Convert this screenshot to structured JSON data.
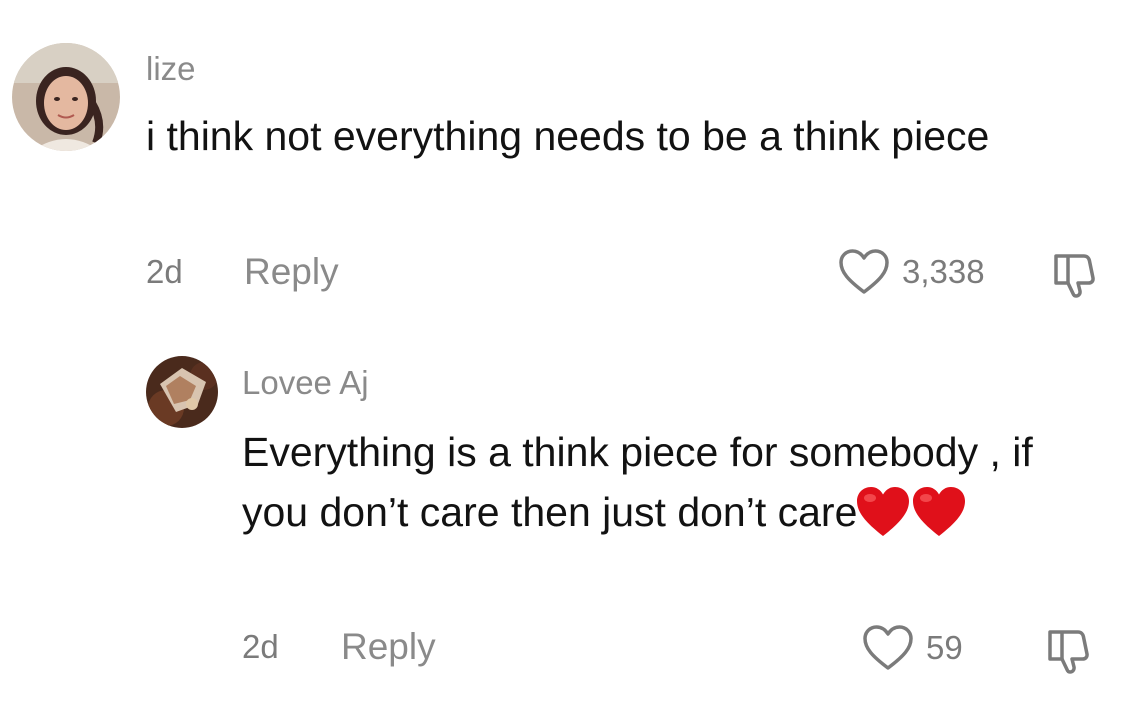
{
  "comments": [
    {
      "username": "lize",
      "text": "i think not everything needs to be a think piece",
      "timestamp": "2d",
      "reply_label": "Reply",
      "like_count": "3,338",
      "avatar": "profile-photo"
    }
  ],
  "replies": [
    {
      "username": "Lovee Aj",
      "text": "Everything is a think piece for somebody , if you don’t care then just don’t care",
      "emoji": [
        "red-heart",
        "red-heart"
      ],
      "timestamp": "2d",
      "reply_label": "Reply",
      "like_count": "59",
      "avatar": "profile-photo"
    }
  ],
  "icons": {
    "like": "heart-outline-icon",
    "dislike": "thumbs-down-outline-icon"
  },
  "colors": {
    "username": "#8a8a8a",
    "text": "#121212",
    "meta": "#7b7b7b",
    "emoji_heart": "#e0101a"
  }
}
